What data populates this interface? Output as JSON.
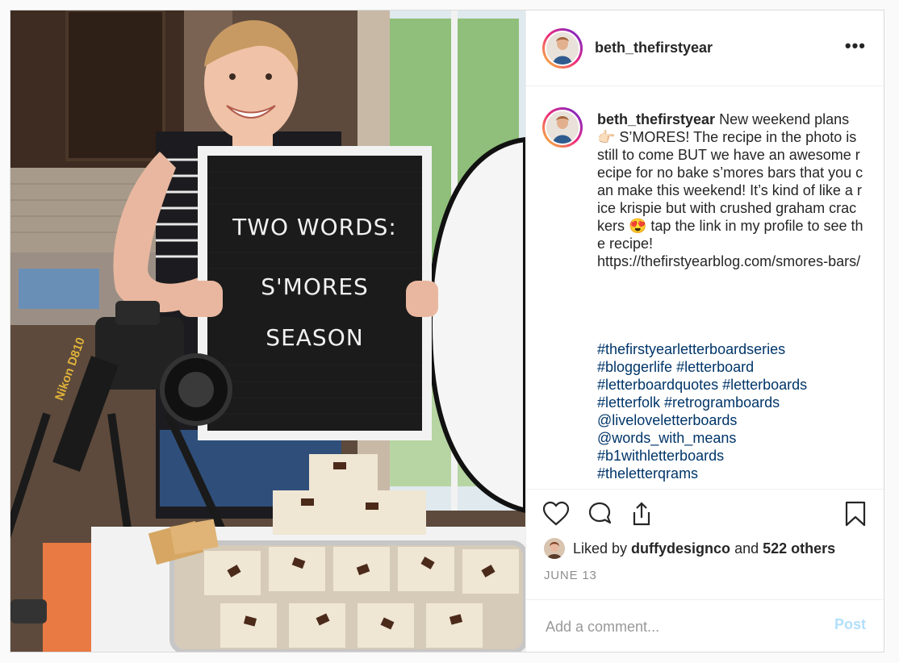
{
  "post": {
    "username": "beth_thefirstyear",
    "more_label": "•••",
    "photo": {
      "board_line1": "TWO WORDS:",
      "board_line2": "S'MORES",
      "board_line3": "SEASON",
      "camera_strap_text": "Nikon D810"
    },
    "caption": {
      "username": "beth_thefirstyear",
      "text": " New weekend plans 👉🏻 S’MORES! The recipe in the photo is still to come BUT we have an awesome recipe for no bake s’mores bars that you can make this weekend! It’s kind of like a rice krispie but with crushed graham crackers 😍 tap the link in my profile to see the recipe!\nhttps://thefirstyearblog.com/smores-bars/",
      "tags": [
        "#thefirstyearletterboardseries",
        "#bloggerlife #letterboard",
        "#letterboardquotes #letterboards",
        "#letterfolk #retrogramboards",
        "@liveloveletterboards",
        "@words_with_means",
        "#b1withletterboards",
        "#theletterqrams"
      ]
    },
    "likes": {
      "prefix": "Liked by ",
      "liker": "duffydesignco",
      "middle": " and ",
      "others": "522 others"
    },
    "date": "JUNE 13",
    "comment_placeholder": "Add a comment...",
    "post_button": "Post",
    "icons": [
      "heart-icon",
      "comment-icon",
      "share-icon",
      "bookmark-icon",
      "more-icon"
    ]
  }
}
